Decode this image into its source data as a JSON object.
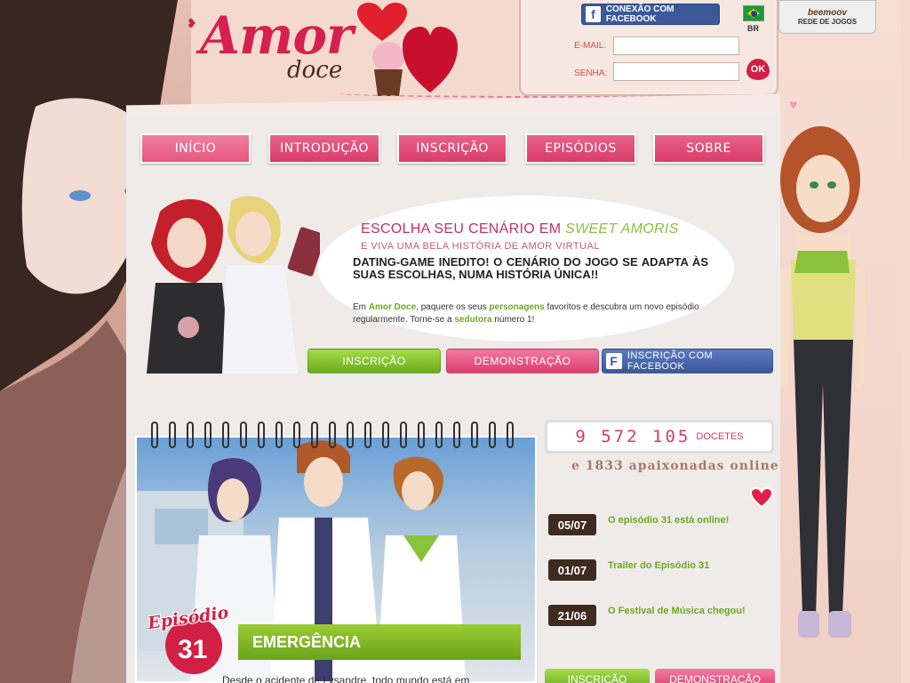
{
  "logo": {
    "word1": "Amor",
    "word2": "doce"
  },
  "login": {
    "facebook_connect": "CONEXÃO COM FACEBOOK",
    "country": "BR",
    "email_label": "E-MAIL:",
    "password_label": "SENHA:",
    "ok_label": "OK"
  },
  "network": {
    "brand": "beemoov",
    "label": "REDE DE JOGOS"
  },
  "nav": {
    "tabs": [
      {
        "label": "Início"
      },
      {
        "label": "Introdução"
      },
      {
        "label": "Inscrição"
      },
      {
        "label": "Episódios"
      },
      {
        "label": "Sobre"
      }
    ]
  },
  "hero": {
    "title_part1": "Escolha seu cenário em ",
    "title_accent": "Sweet Amoris",
    "subtitle": "e viva uma bela história de amor virtual",
    "bold": "Dating-game inedito! O cenário do jogo se adapta às suas escolhas, numa história única!!",
    "desc_part1": "Em ",
    "desc_brand": "Amor Doce",
    "desc_part2": ", paquere os seus ",
    "desc_characters": "personagens",
    "desc_part3": " favoritos e descubra um novo episódio regularmente. Torne-se a ",
    "desc_seductress": "sedutora",
    "desc_part4": " número 1!",
    "btn_signup": "Inscrição",
    "btn_demo": "Demonstração",
    "btn_facebook": "Inscrição com Facebook"
  },
  "episode": {
    "word": "Episódio",
    "number": "31",
    "title": "EMERGÊNCIA",
    "text": "Desde o acidente de Lysandre, todo mundo está em"
  },
  "stats": {
    "count": "9 572 105",
    "unit": "docetes",
    "online": "e 1833 apaixonadas online"
  },
  "news": [
    {
      "date": "05/07",
      "title": "O episódio 31 está online!"
    },
    {
      "date": "01/07",
      "title": "Trailer do Episódio 31"
    },
    {
      "date": "21/06",
      "title": "O Festival de Música chegou!"
    }
  ],
  "bottom_buttons": {
    "signup": "Inscrição",
    "demo": "Demonstração"
  },
  "colors": {
    "brand_pink": "#d6204e",
    "green": "#6ea821",
    "facebook": "#3b5998"
  }
}
